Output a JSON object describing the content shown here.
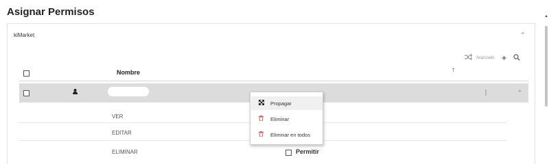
{
  "page": {
    "title": "Asignar Permisos"
  },
  "panel": {
    "name": "kiMarket",
    "collapse_icon": "chevron-up"
  },
  "toolbar": {
    "shuffle_icon": "shuffle",
    "advanced_label": "Avanzado",
    "add_icon": "plus",
    "search_icon": "search"
  },
  "table": {
    "header": {
      "name_label": "Nombre",
      "sort_icon": "arrow-up"
    },
    "group": {
      "user_icon": "user",
      "name_redacted": true,
      "expand_icon": "chevron-up"
    },
    "permissions": [
      {
        "label": "VER"
      },
      {
        "label": "EDITAR"
      },
      {
        "label": "ELIMINAR",
        "allow_label": "Permitir"
      }
    ]
  },
  "context_menu": {
    "items": [
      {
        "label": "Propagar",
        "icon": "expand-arrows",
        "highlighted": true
      },
      {
        "label": "Eliminar",
        "icon": "trash"
      },
      {
        "label": "Eliminar en todos",
        "icon": "trash"
      }
    ]
  },
  "colors": {
    "danger": "#e05a5a",
    "row_highlight": "#dcdcdc"
  }
}
